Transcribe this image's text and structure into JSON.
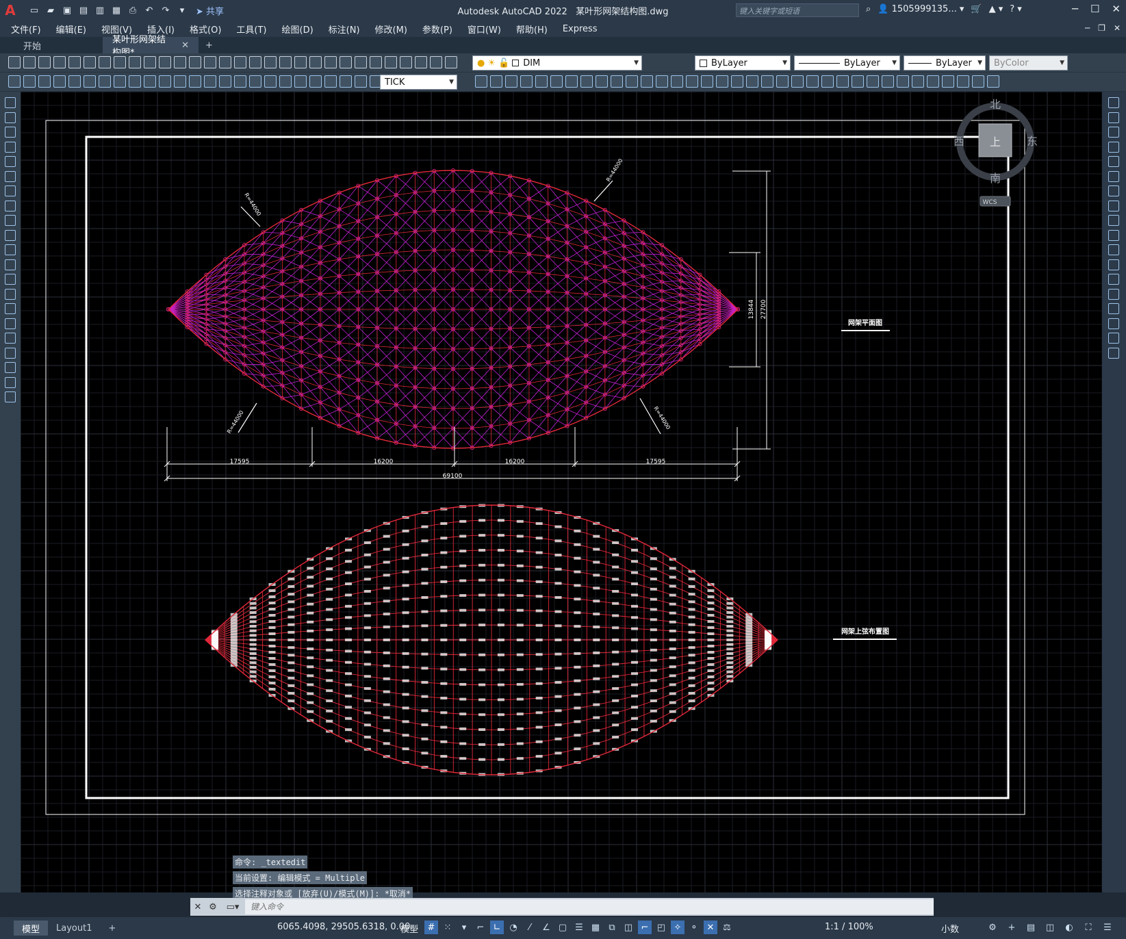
{
  "app": {
    "title": "Autodesk AutoCAD 2022",
    "filename": "某叶形网架结构图.dwg",
    "share_label": "共享",
    "search_placeholder": "键入关键字或短语",
    "user": "1505999135...",
    "logo": "A"
  },
  "menu": [
    "文件(F)",
    "编辑(E)",
    "视图(V)",
    "插入(I)",
    "格式(O)",
    "工具(T)",
    "绘图(D)",
    "标注(N)",
    "修改(M)",
    "参数(P)",
    "窗口(W)",
    "帮助(H)",
    "Express"
  ],
  "tabs": [
    {
      "label": "开始"
    },
    {
      "label": "某叶形网架结构图*"
    }
  ],
  "toolbar": {
    "layer": "DIM",
    "color": "ByLayer",
    "linetype": "ByLayer",
    "lineweight": "ByLayer",
    "plotstyle": "ByColor",
    "dimstyle": "TICK"
  },
  "viewcube": {
    "north": "北",
    "south": "南",
    "east": "东",
    "west": "西",
    "top": "上",
    "wcs": "WCS"
  },
  "drawing": {
    "plan_title": "网架平面图",
    "bottom_title": "网架上弦布置图",
    "radius_label": "R=44000",
    "dims": {
      "d1": "17595",
      "d2": "16200",
      "d3": "16200",
      "d4": "17595",
      "total": "69100",
      "v1": "13844",
      "v2": "27700"
    }
  },
  "command": {
    "history": [
      "命令: _textedit",
      "当前设置: 编辑模式 = Multiple",
      "选择注释对象或 [放弃(U)/模式(M)]: *取消*"
    ],
    "placeholder": "键入命令"
  },
  "status": {
    "layouts": [
      {
        "label": "模型"
      },
      {
        "label": "Layout1"
      }
    ],
    "coords": "6065.4098, 29505.6318, 0.00...",
    "space": "模型",
    "scale": "1:1 / 100%",
    "units": "小数"
  },
  "colors": {
    "frame": "#ffffff",
    "grid_minor": "#1a1d24",
    "grid_major": "#2b2f3a",
    "chord_red": "#e0283a",
    "web_magenta": "#c41fd6",
    "node": "#d61f78",
    "dim": "#ffffff"
  }
}
